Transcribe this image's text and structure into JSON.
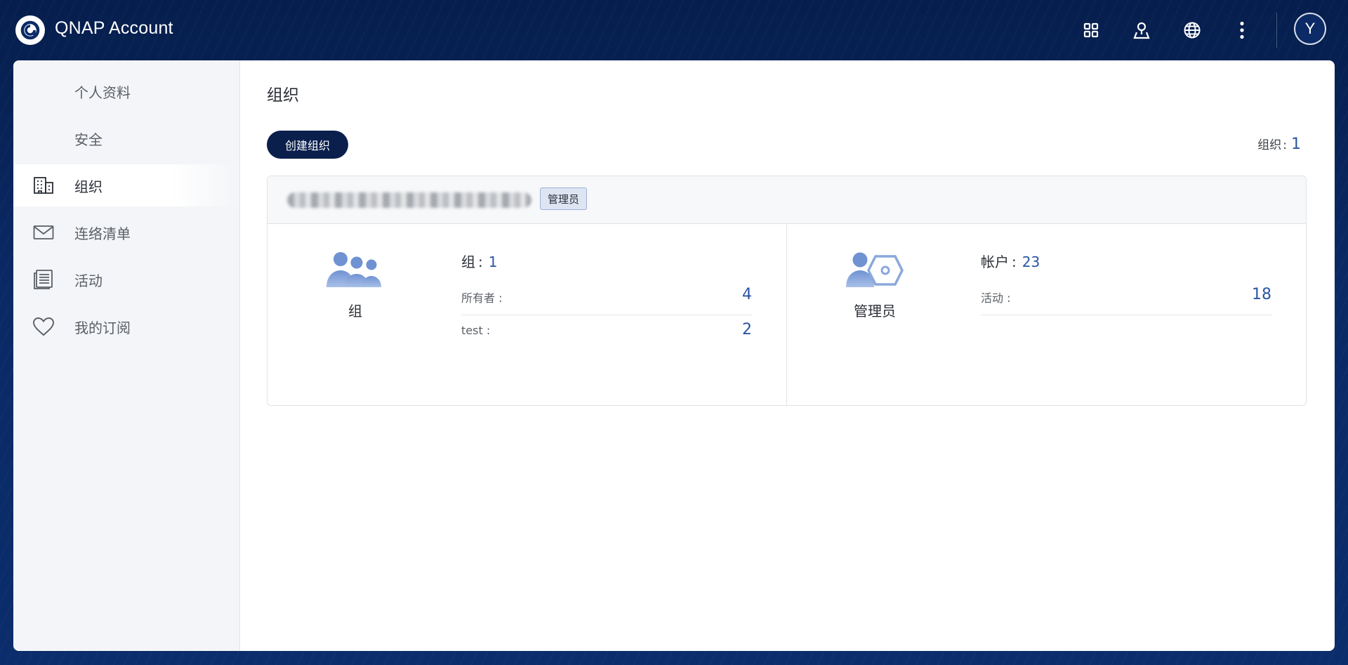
{
  "app": {
    "brand": "QNAP Account"
  },
  "topbar": {
    "icons": [
      "apps-grid-icon",
      "location-pin-icon",
      "globe-icon",
      "more-vertical-icon"
    ],
    "avatar_initial": "Y"
  },
  "sidebar": {
    "items": [
      {
        "label": "个人资料",
        "icon": "none",
        "active": false
      },
      {
        "label": "安全",
        "icon": "none",
        "active": false
      },
      {
        "label": "组织",
        "icon": "building-icon",
        "active": true
      },
      {
        "label": "连络清单",
        "icon": "envelope-icon",
        "active": false
      },
      {
        "label": "活动",
        "icon": "activity-list-icon",
        "active": false
      },
      {
        "label": "我的订阅",
        "icon": "heart-icon",
        "active": false
      }
    ]
  },
  "main": {
    "title": "组织",
    "create_button": "创建组织",
    "org_count": {
      "label": "组织",
      "separator": ":",
      "value": "1"
    },
    "organization": {
      "role_badge": "管理员",
      "groups": {
        "icon_label": "组",
        "main_label": "组",
        "separator": ":",
        "main_value": "1",
        "rows": [
          {
            "label": "所有者 :",
            "value": "4"
          },
          {
            "label": "test :",
            "value": "2"
          }
        ]
      },
      "admins": {
        "icon_label": "管理员",
        "main_label": "帐户",
        "separator": ":",
        "main_value": "23",
        "rows": [
          {
            "label": "活动 :",
            "value": "18"
          }
        ]
      }
    }
  },
  "colors": {
    "header_bg": "#061e4d",
    "primary_button": "#0b1f4d",
    "value_blue": "#2a55a3",
    "icon_blue": "#7b9ed8"
  }
}
